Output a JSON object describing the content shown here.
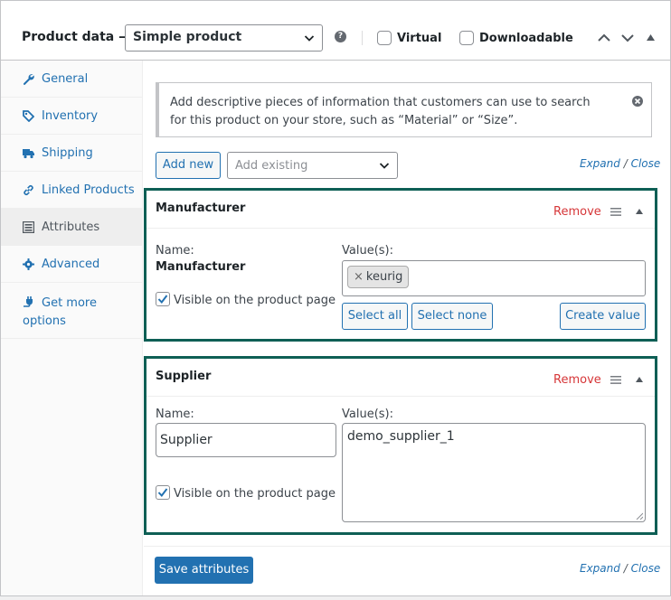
{
  "header": {
    "title": "Product data —",
    "product_type": "Simple product",
    "virtual_label": "Virtual",
    "downloadable_label": "Downloadable"
  },
  "sidebar": {
    "items": [
      {
        "label": "General",
        "icon": "wrench-icon"
      },
      {
        "label": "Inventory",
        "icon": "tag-icon"
      },
      {
        "label": "Shipping",
        "icon": "truck-icon"
      },
      {
        "label": "Linked Products",
        "icon": "link-icon"
      },
      {
        "label": "Attributes",
        "icon": "list-icon",
        "active": true
      },
      {
        "label": "Advanced",
        "icon": "gear-icon"
      },
      {
        "label": "Get more options",
        "icon": "plugin-icon"
      }
    ]
  },
  "notice": {
    "text": "Add descriptive pieces of information that customers can use to search for this product on your store, such as “Material” or “Size”."
  },
  "toolbar": {
    "add_new": "Add new",
    "add_existing_placeholder": "Add existing",
    "expand": "Expand",
    "slash": "/",
    "close": "Close"
  },
  "attributes": [
    {
      "title": "Manufacturer",
      "remove": "Remove",
      "name_label": "Name:",
      "name_value": "Manufacturer",
      "values_label": "Value(s):",
      "tags": [
        "keurig"
      ],
      "tag_remove": "×",
      "visible_label": "Visible on the product page",
      "visible_checked": true,
      "select_all": "Select all",
      "select_none": "Select none",
      "create_value": "Create value"
    },
    {
      "title": "Supplier",
      "remove": "Remove",
      "name_label": "Name:",
      "name_value": "Supplier",
      "values_label": "Value(s):",
      "values_text": "demo_supplier_1",
      "visible_label": "Visible on the product page",
      "visible_checked": true
    }
  ],
  "footer": {
    "save": "Save attributes",
    "expand": "Expand",
    "slash": "/",
    "close": "Close"
  },
  "colors": {
    "accent": "#2271b1",
    "highlight_border": "#0e5f55",
    "remove": "#d63638"
  }
}
